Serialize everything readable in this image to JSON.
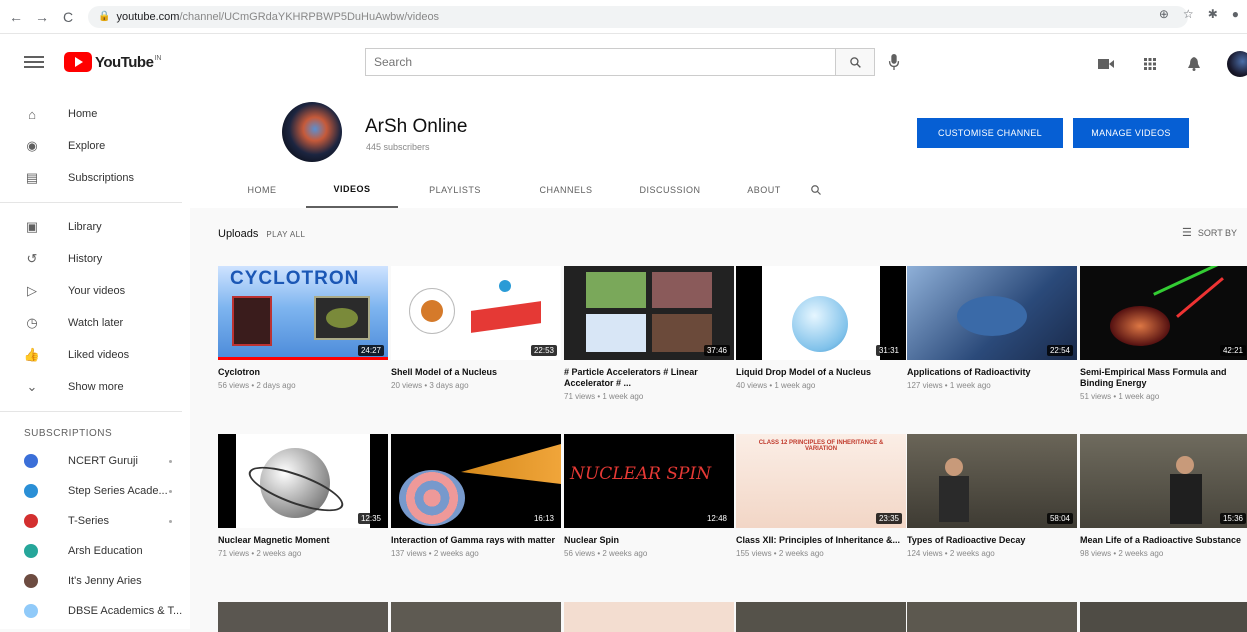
{
  "browser": {
    "url_host": "youtube.com",
    "url_path": "/channel/UCmGRdaYKHRPBWP5DuHuAwbw/videos",
    "nav": [
      "←",
      "→",
      "C"
    ]
  },
  "header": {
    "logo_text": "YouTube",
    "logo_sup": "IN",
    "search_placeholder": "Search"
  },
  "sidebar": {
    "main": [
      {
        "label": "Home",
        "icon": "home-icon",
        "glyph": "⌂"
      },
      {
        "label": "Explore",
        "icon": "compass-icon",
        "glyph": "◉"
      },
      {
        "label": "Subscriptions",
        "icon": "subscriptions-icon",
        "glyph": "▤"
      }
    ],
    "library": [
      {
        "label": "Library",
        "icon": "library-icon",
        "glyph": "▣"
      },
      {
        "label": "History",
        "icon": "history-icon",
        "glyph": "↺"
      },
      {
        "label": "Your videos",
        "icon": "your-videos-icon",
        "glyph": "▷"
      },
      {
        "label": "Watch later",
        "icon": "watch-later-icon",
        "glyph": "◷"
      },
      {
        "label": "Liked videos",
        "icon": "like-icon",
        "glyph": "👍"
      },
      {
        "label": "Show more",
        "icon": "chevron-down-icon",
        "glyph": "⌄"
      }
    ],
    "subs_heading": "SUBSCRIPTIONS",
    "subscriptions": [
      {
        "label": "NCERT Guruji",
        "color": "#3b6fd8"
      },
      {
        "label": "Step Series Acade...",
        "color": "#2a8fd6"
      },
      {
        "label": "T-Series",
        "color": "#d32f2f"
      },
      {
        "label": "Arsh Education",
        "color": "#26a69a"
      },
      {
        "label": "It's Jenny Aries",
        "color": "#6d4c41"
      },
      {
        "label": "DBSE Academics & T...",
        "color": "#90caf9"
      }
    ]
  },
  "channel": {
    "name": "ArSh Online",
    "subscribers": "445 subscribers",
    "customise_label": "CUSTOMISE CHANNEL",
    "manage_label": "MANAGE VIDEOS",
    "tabs": [
      "HOME",
      "VIDEOS",
      "PLAYLISTS",
      "CHANNELS",
      "DISCUSSION",
      "ABOUT"
    ],
    "active_tab": "VIDEOS"
  },
  "uploads": {
    "title": "Uploads",
    "play_all": "PLAY ALL",
    "sort_by": "SORT BY"
  },
  "videos": [
    {
      "title": "Cyclotron",
      "meta": "56 views • 2 days ago",
      "duration": "24:27",
      "progress": 1.0,
      "thumb_text": "CYCLOTRON"
    },
    {
      "title": "Shell Model of a Nucleus",
      "meta": "20 views • 3 days ago",
      "duration": "22:53",
      "progress": 0.0,
      "thumb_text": ""
    },
    {
      "title": "# Particle Accelerators # Linear Accelerator # ...",
      "meta": "71 views • 1 week ago",
      "duration": "37:46",
      "progress": 0.0,
      "thumb_text": ""
    },
    {
      "title": "Liquid Drop Model of a Nucleus",
      "meta": "40 views • 1 week ago",
      "duration": "31:31",
      "progress": 0.0,
      "thumb_text": ""
    },
    {
      "title": "Applications of Radioactivity",
      "meta": "127 views • 1 week ago",
      "duration": "22:54",
      "progress": 0.0,
      "thumb_text": ""
    },
    {
      "title": "Semi-Empirical Mass Formula and Binding Energy",
      "meta": "51 views • 1 week ago",
      "duration": "42:21",
      "progress": 0.0,
      "thumb_text": ""
    },
    {
      "title": "Nuclear Magnetic Moment",
      "meta": "71 views • 2 weeks ago",
      "duration": "12:35",
      "progress": 0.0,
      "thumb_text": ""
    },
    {
      "title": "Interaction of Gamma rays with matter",
      "meta": "137 views • 2 weeks ago",
      "duration": "16:13",
      "progress": 0.0,
      "thumb_text": ""
    },
    {
      "title": "Nuclear Spin",
      "meta": "56 views • 2 weeks ago",
      "duration": "12:48",
      "progress": 0.0,
      "thumb_text": "NUCLEAR SPIN"
    },
    {
      "title": "Class XII: Principles of Inheritance &...",
      "meta": "155 views • 2 weeks ago",
      "duration": "23:35",
      "progress": 0.0,
      "thumb_text": "CLASS 12 PRINCIPLES OF INHERITANCE & VARIATION"
    },
    {
      "title": "Types of Radioactive Decay",
      "meta": "124 views • 2 weeks ago",
      "duration": "58:04",
      "progress": 0.0,
      "thumb_text": ""
    },
    {
      "title": "Mean Life of a Radioactive Substance",
      "meta": "98 views • 2 weeks ago",
      "duration": "15:36",
      "progress": 0.0,
      "thumb_text": ""
    }
  ],
  "colors": {
    "accent": "#065fd4",
    "brand_red": "#ff0000"
  }
}
